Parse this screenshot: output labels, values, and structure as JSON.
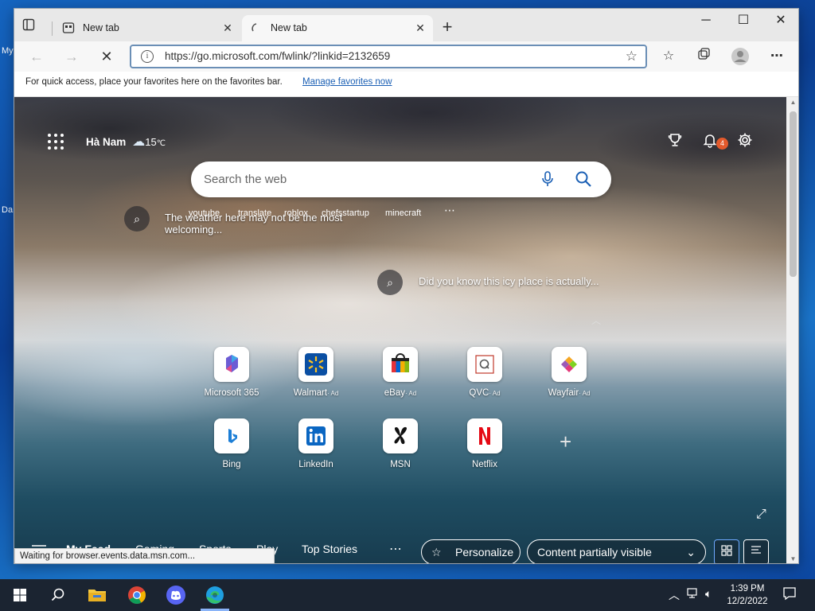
{
  "desktop": {
    "labels": [
      "My",
      "Da"
    ]
  },
  "tabs": [
    {
      "title": "New tab",
      "active": false
    },
    {
      "title": "New tab",
      "active": true
    }
  ],
  "window": {
    "minimize": "─",
    "maximize": "☐",
    "close": "✕"
  },
  "address_bar": {
    "url": "https://go.microsoft.com/fwlink/?linkid=2132659"
  },
  "favorites_bar": {
    "message": "For quick access, place your favorites here on the favorites bar.",
    "link": "Manage favorites now"
  },
  "ntp": {
    "location": "Hà Nam",
    "temperature": "15",
    "temp_unit": "℃",
    "notification_count": "4",
    "search_placeholder": "Search the web",
    "trending": [
      "youtube",
      "translate",
      "roblox",
      "chefsstartup",
      "minecraft"
    ],
    "overlay_text_1": "The weather here may not be the most welcoming...",
    "overlay_text_2": "Did you know this icy place is actually...",
    "quick_links": [
      {
        "label": "Microsoft 365",
        "ad": ""
      },
      {
        "label": "Walmart",
        "ad": "· Ad"
      },
      {
        "label": "eBay",
        "ad": "· Ad"
      },
      {
        "label": "QVC",
        "ad": "· Ad"
      },
      {
        "label": "Wayfair",
        "ad": "· Ad"
      },
      {
        "label": "Bing",
        "ad": ""
      },
      {
        "label": "LinkedIn",
        "ad": ""
      },
      {
        "label": "MSN",
        "ad": ""
      },
      {
        "label": "Netflix",
        "ad": ""
      }
    ],
    "feed_nav": [
      "My Feed",
      "Gaming",
      "Sports",
      "Play",
      "Top Stories"
    ],
    "personalize": "Personalize",
    "content_visibility": "Content partially visible"
  },
  "status_bar": "Waiting for browser.events.data.msn.com...",
  "taskbar": {
    "time": "1:39 PM",
    "date": "12/2/2022"
  },
  "colors": {
    "accent": "#1a5fb4",
    "badge": "#e35a2c",
    "taskbar": "#1b2431"
  }
}
